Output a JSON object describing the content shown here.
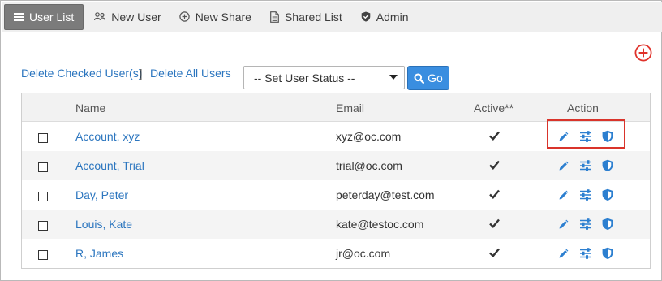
{
  "nav": {
    "items": [
      {
        "label": "User List",
        "icon": "list-icon",
        "active": true
      },
      {
        "label": "New User",
        "icon": "users-icon",
        "active": false
      },
      {
        "label": "New Share",
        "icon": "plus-circle-icon",
        "active": false
      },
      {
        "label": "Shared List",
        "icon": "document-icon",
        "active": false
      },
      {
        "label": "Admin",
        "icon": "shield-check-icon",
        "active": false
      }
    ]
  },
  "actions": {
    "delete_checked": "Delete Checked User(s)",
    "separator": "|",
    "delete_all": "Delete All Users",
    "status_select": "-- Set User Status --",
    "go_label": "Go"
  },
  "table": {
    "headers": {
      "name": "Name",
      "email": "Email",
      "active": "Active**",
      "action": "Action"
    },
    "rows": [
      {
        "name": "Account, xyz",
        "email": "xyz@oc.com",
        "active": true
      },
      {
        "name": "Account, Trial",
        "email": "trial@oc.com",
        "active": true
      },
      {
        "name": "Day, Peter",
        "email": "peterday@test.com",
        "active": true
      },
      {
        "name": "Louis, Kate",
        "email": "kate@testoc.com",
        "active": true
      },
      {
        "name": "R, James",
        "email": "jr@oc.com",
        "active": true
      }
    ]
  },
  "colors": {
    "link": "#2c76bf",
    "go_button": "#3a8ee0",
    "active_tab": "#7b7b7b",
    "highlight": "#d9342b",
    "add_icon": "#e0322b"
  }
}
